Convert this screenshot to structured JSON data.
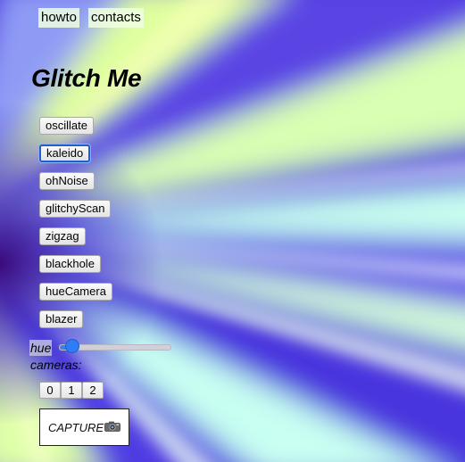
{
  "nav": {
    "links": [
      {
        "label": "howto"
      },
      {
        "label": "contacts"
      }
    ]
  },
  "title": "Glitch Me",
  "effects": [
    {
      "label": "oscillate",
      "focused": false
    },
    {
      "label": "kaleido",
      "focused": true
    },
    {
      "label": "ohNoise",
      "focused": false
    },
    {
      "label": "glitchyScan",
      "focused": false
    },
    {
      "label": "zigzag",
      "focused": false
    },
    {
      "label": "blackhole",
      "focused": false
    },
    {
      "label": "hueCamera",
      "focused": false
    },
    {
      "label": "blazer",
      "focused": false
    }
  ],
  "hue": {
    "label": "hue",
    "value": 0.12
  },
  "cameras": {
    "label": "cameras:",
    "options": [
      "0",
      "1",
      "2"
    ]
  },
  "capture": {
    "label": "CAPTURE",
    "icon": "camera-icon"
  },
  "colors": {
    "accent": "#2f7cf6",
    "focus_ring": "#1e5fd6",
    "background_violet": "#3a1fd0",
    "background_lime": "#e6ffb0"
  }
}
